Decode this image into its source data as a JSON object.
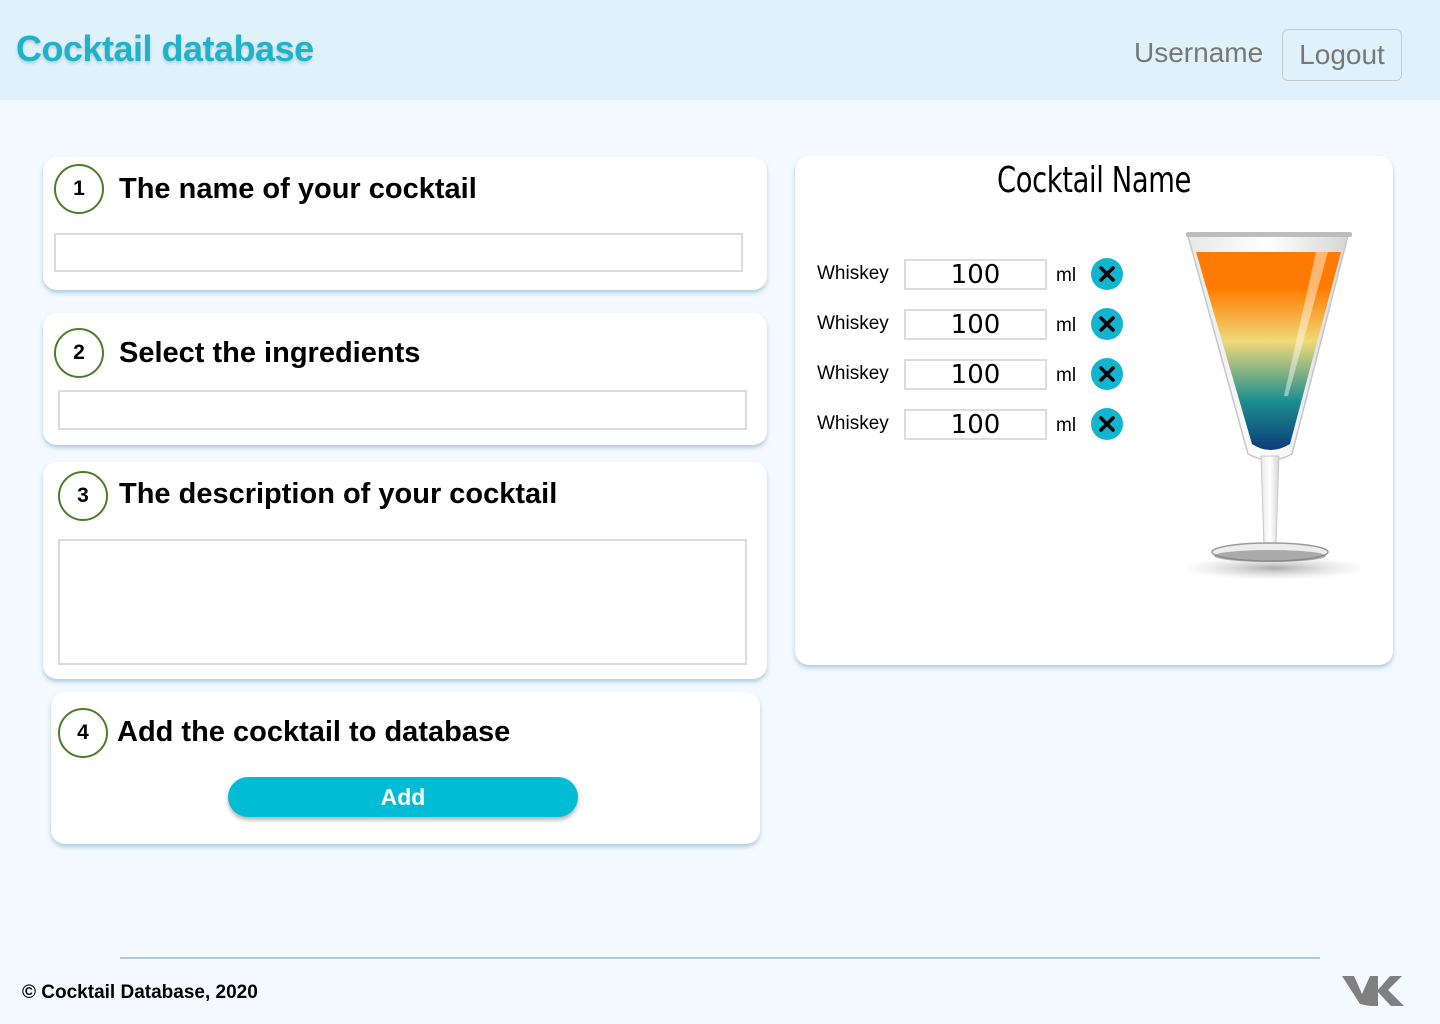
{
  "header": {
    "logo": "Cocktail database",
    "username": "Username",
    "logout_label": "Logout"
  },
  "steps": [
    {
      "number": "1",
      "title": "The name of your cocktail",
      "field_value": ""
    },
    {
      "number": "2",
      "title": "Select the ingredients",
      "field_value": ""
    },
    {
      "number": "3",
      "title": "The description of your cocktail",
      "field_value": ""
    },
    {
      "number": "4",
      "title": "Add the cocktail to database",
      "button_label": "Add"
    }
  ],
  "preview": {
    "title": "Cocktail Name",
    "ingredients": [
      {
        "name": "Whiskey",
        "amount": "100",
        "unit": "ml"
      },
      {
        "name": "Whiskey",
        "amount": "100",
        "unit": "ml"
      },
      {
        "name": "Whiskey",
        "amount": "100",
        "unit": "ml"
      },
      {
        "name": "Whiskey",
        "amount": "100",
        "unit": "ml"
      }
    ],
    "glass_layer_colors": [
      "#ff7a00",
      "#f0d978",
      "#1e8f8f",
      "#0a3d7a"
    ]
  },
  "footer": {
    "copyright": "© Cocktail Database, 2020",
    "social_icon": "vk-icon"
  },
  "colors": {
    "accent": "#00bcd4",
    "header_bg": "#dff2fc",
    "page_bg": "#f3f9fe",
    "step_ring": "#4e7d2a"
  }
}
